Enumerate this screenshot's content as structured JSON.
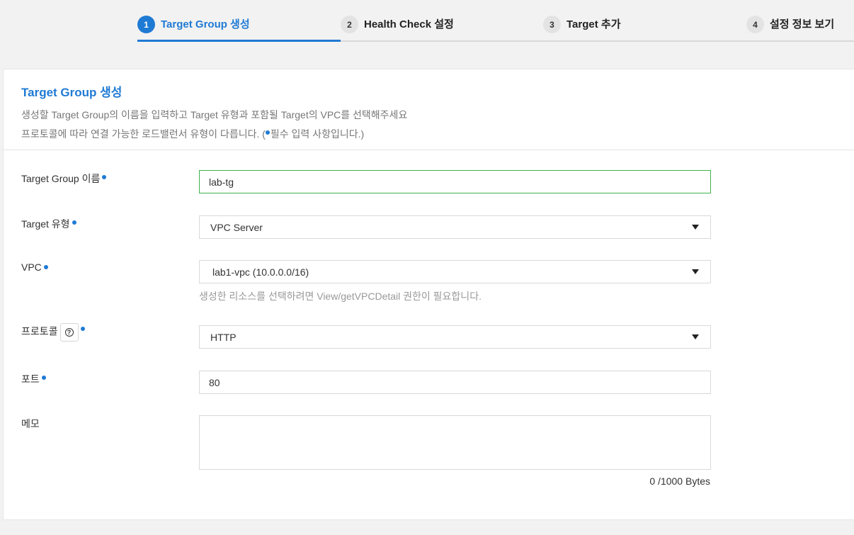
{
  "stepper": {
    "steps": [
      {
        "num": "1",
        "label": "Target Group 생성"
      },
      {
        "num": "2",
        "label": "Health Check 설정"
      },
      {
        "num": "3",
        "label": "Target 추가"
      },
      {
        "num": "4",
        "label": "설정 정보 보기"
      }
    ],
    "active_step": 1
  },
  "panel": {
    "title": "Target Group 생성",
    "desc_line1": "생성할 Target Group의 이름을 입력하고 Target 유형과 포함될 Target의 VPC를 선택해주세요",
    "desc_line2_prefix": "프로토콜에 따라 연결 가능한 로드밸런서 유형이 다릅니다. (",
    "desc_line2_suffix": "필수 입력 사항입니다.)"
  },
  "form": {
    "name": {
      "label": "Target Group 이름",
      "value": "lab-tg",
      "required": true
    },
    "target_type": {
      "label": "Target 유형",
      "value": "VPC Server",
      "required": true
    },
    "vpc": {
      "label": "VPC",
      "value": "lab1-vpc (10.0.0.0/16)",
      "required": true,
      "help": "생성한 리소스를 선택하려면 View/getVPCDetail 권한이 필요합니다."
    },
    "protocol": {
      "label": "프로토콜",
      "value": "HTTP",
      "required": true,
      "help_icon": "question-circle-icon"
    },
    "port": {
      "label": "포트",
      "value": "80",
      "required": true
    },
    "memo": {
      "label": "메모",
      "value": "",
      "counter": "0 /1000 Bytes"
    }
  },
  "colors": {
    "accent": "#1f7ad4",
    "focus_border": "#3fb34f"
  }
}
